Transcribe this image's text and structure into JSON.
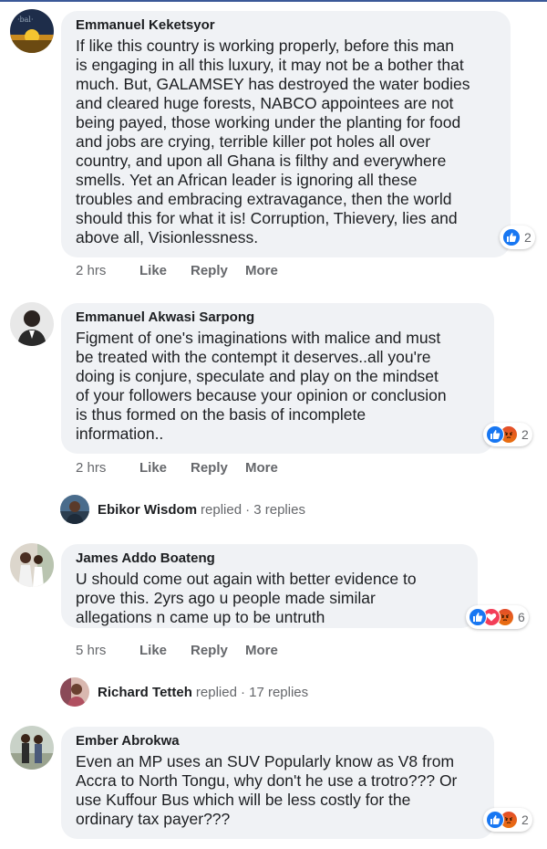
{
  "comments": [
    {
      "author": "Emmanuel Keketsyor",
      "lines": [
        "If like this country is working properly, before this man",
        "is engaging in all this luxury, it may not be a bother that",
        "much. But, GALAMSEY has destroyed the water bodies",
        "and cleared huge forests, NABCO appointees are not",
        "being payed, those working under the planting for food",
        "and jobs are crying, terrible killer pot holes all over",
        "country, and upon all Ghana is filthy and everywhere",
        "smells. Yet an African leader is ignoring all these",
        "troubles and embracing extravagance, then the world",
        "should this for what it is! Corruption, Thievery, lies and",
        "above all, Visionlessness."
      ],
      "reactions": [
        "like"
      ],
      "reaction_count": "2",
      "time": "2 hrs",
      "like": "Like",
      "reply": "Reply",
      "more": "More"
    },
    {
      "author": "Emmanuel Akwasi Sarpong",
      "lines": [
        "Figment of one's imaginations with malice and must",
        "be treated with the contempt it deserves..all you're",
        "doing is conjure, speculate and play on the mindset",
        "of your followers because your opinion or conclusion",
        "is thus formed on the basis of incomplete",
        "information.."
      ],
      "reactions": [
        "like",
        "angry"
      ],
      "reaction_count": "2",
      "time": "2 hrs",
      "like": "Like",
      "reply": "Reply",
      "more": "More"
    },
    {
      "author": "James Addo Boateng",
      "lines": [
        "U should come out again with better evidence to",
        "prove this. 2yrs ago u people made similar",
        "allegations n came up to be untruth"
      ],
      "reactions": [
        "like",
        "love",
        "angry"
      ],
      "reaction_count": "6",
      "time": "5 hrs",
      "like": "Like",
      "reply": "Reply",
      "more": "More"
    },
    {
      "author": "Ember Abrokwa",
      "lines": [
        "Even an MP uses an SUV Popularly know as V8 from",
        "Accra to North Tongu, why don't he use a trotro??? Or",
        "use Kuffour Bus which will be less costly for the",
        "ordinary tax payer???"
      ],
      "reactions": [
        "like",
        "angry"
      ],
      "reaction_count": "2"
    }
  ],
  "replies": [
    {
      "name": "Ebikor Wisdom",
      "verb": "replied",
      "count": "· 3 replies"
    },
    {
      "name": "Richard Tetteh",
      "verb": "replied",
      "count": "· 17 replies"
    }
  ],
  "colors": {
    "like": "#1877f2",
    "love": "#f33e58",
    "angry": "#e9710f",
    "bubble": "#f0f2f5"
  }
}
